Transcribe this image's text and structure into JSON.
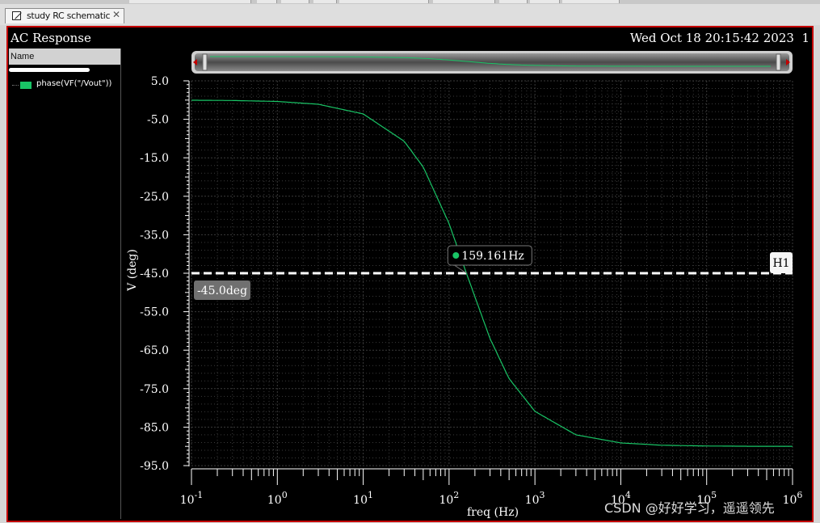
{
  "tab": {
    "label": "study RC schematic",
    "close_glyph": "✕",
    "icon": "schematic-icon"
  },
  "window": {
    "title": "AC Response",
    "timestamp": "Wed Oct 18 20:15:42 2023  1"
  },
  "legend_panel": {
    "header": "Name",
    "items": [
      {
        "label": "phase(VF(\"/Vout\"))",
        "color": "#19c566"
      }
    ]
  },
  "colors": {
    "trace": "#19c566",
    "background": "#000000",
    "border": "#c40000",
    "grid": "#3a3a3a"
  },
  "chart_data": {
    "type": "line",
    "title": "",
    "xlabel": "freq (Hz)",
    "ylabel": "V (deg)",
    "x_scale": "log",
    "xlim": [
      0.1,
      1000000
    ],
    "ylim": [
      -95,
      5
    ],
    "y_ticks": [
      5.0,
      -5.0,
      -15.0,
      -25.0,
      -35.0,
      -45.0,
      -55.0,
      -65.0,
      -75.0,
      -85.0,
      -95.0
    ],
    "y_tick_labels": [
      "5.0",
      "-5.0",
      "-15.0",
      "-25.0",
      "-35.0",
      "-45.0",
      "-55.0",
      "-65.0",
      "-75.0",
      "-85.0",
      "-95.0"
    ],
    "x_ticks": [
      0.1,
      1,
      10,
      100,
      1000,
      10000,
      100000,
      1000000
    ],
    "x_tick_labels": [
      {
        "base": "10",
        "exp": "-1"
      },
      {
        "base": "10",
        "exp": "0"
      },
      {
        "base": "10",
        "exp": "1"
      },
      {
        "base": "10",
        "exp": "2"
      },
      {
        "base": "10",
        "exp": "3"
      },
      {
        "base": "10",
        "exp": "4"
      },
      {
        "base": "10",
        "exp": "5"
      },
      {
        "base": "10",
        "exp": "6"
      }
    ],
    "grid": true,
    "series": [
      {
        "name": "phase(VF(\"/Vout\"))",
        "color": "#19c566",
        "x": [
          0.1,
          0.3,
          1,
          3,
          10,
          30,
          50,
          100,
          159.161,
          300,
          500,
          1000,
          3000,
          10000,
          30000,
          100000,
          300000,
          1000000
        ],
        "y": [
          -0.04,
          -0.11,
          -0.36,
          -1.08,
          -3.6,
          -10.7,
          -17.4,
          -32.1,
          -45.0,
          -62.0,
          -72.4,
          -80.9,
          -87.0,
          -89.1,
          -89.7,
          -89.9,
          -89.97,
          -89.99
        ]
      }
    ],
    "hline": {
      "label": "H1",
      "value": -45.0,
      "value_label": "-45.0deg"
    },
    "marker": {
      "x": 159.161,
      "y": -45.0,
      "label": "159.161Hz"
    }
  },
  "watermark": "CSDN @好好学习，遥遥领先"
}
